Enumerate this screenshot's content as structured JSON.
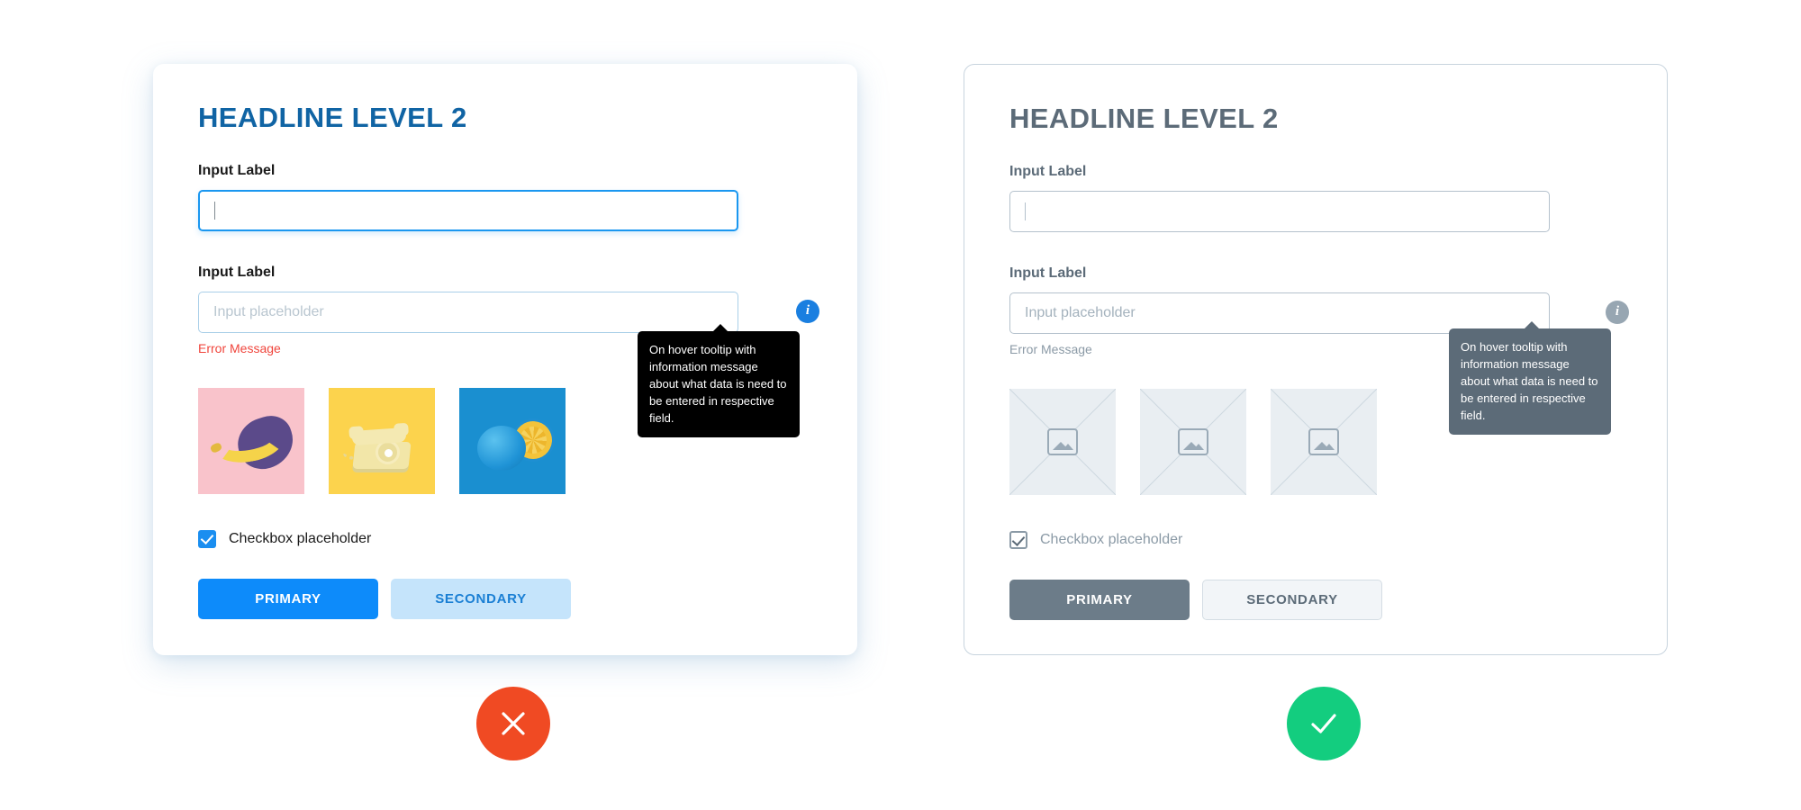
{
  "page": {
    "background_color": "#ffffff",
    "description": "Form design comparison: accessible colored variant vs low-contrast grayscale variant"
  },
  "cards": [
    {
      "id": "color-card",
      "variant": "color",
      "headline": "HEADLINE LEVEL 2",
      "headline_color": "#1064a4",
      "fields": [
        {
          "label": "Input Label",
          "state": "focused",
          "value": "",
          "placeholder": "",
          "border_color": "#1a97f0"
        },
        {
          "label": "Input Label",
          "state": "error",
          "value": "",
          "placeholder": "Input placeholder",
          "error": "Error Message",
          "error_color": "#f0453c",
          "info_icon": "info-icon",
          "info_icon_color": "#1a7fe0"
        }
      ],
      "tooltip": {
        "text": "On hover tooltip with information message about what data is need to be entered in respective field.",
        "background_color": "#000000",
        "text_color": "#ffffff"
      },
      "thumbnails": [
        {
          "name": "banana-photo",
          "alt": "Yellow banana on pink background",
          "background_color": "#f9c3cb"
        },
        {
          "name": "rotary-phone-photo",
          "alt": "Vintage rotary phone on yellow background",
          "background_color": "#fcd34d"
        },
        {
          "name": "blue-orange-photo",
          "alt": "Blue painted orange on blue background",
          "background_color": "#1a8fd0"
        }
      ],
      "checkbox": {
        "label": "Checkbox placeholder",
        "checked": true,
        "color": "#1a8ef0"
      },
      "buttons": {
        "primary": "PRIMARY",
        "primary_color": "#0d8bfa",
        "secondary": "SECONDARY",
        "secondary_color": "#c5e4fb"
      }
    },
    {
      "id": "gray-card",
      "variant": "grayscale",
      "headline": "HEADLINE LEVEL 2",
      "headline_color": "#5c6b78",
      "fields": [
        {
          "label": "Input Label",
          "state": "default",
          "value": "",
          "placeholder": "",
          "border_color": "#b4c1cc"
        },
        {
          "label": "Input Label",
          "state": "error",
          "value": "",
          "placeholder": "Input placeholder",
          "error": "Error Message",
          "error_color": "#8b9aa6",
          "info_icon": "info-icon",
          "info_icon_color": "#97a6b2"
        }
      ],
      "tooltip": {
        "text": "On hover tooltip with information message about what data is need to be entered in respective field.",
        "background_color": "#5c6b78",
        "text_color": "#ffffff"
      },
      "thumbnails": [
        {
          "name": "image-placeholder",
          "alt": "Image placeholder",
          "background_color": "#e9eef2"
        },
        {
          "name": "image-placeholder",
          "alt": "Image placeholder",
          "background_color": "#e9eef2"
        },
        {
          "name": "image-placeholder",
          "alt": "Image placeholder",
          "background_color": "#e9eef2"
        }
      ],
      "checkbox": {
        "label": "Checkbox placeholder",
        "checked": true,
        "color": "#8b9aa6"
      },
      "buttons": {
        "primary": "PRIMARY",
        "primary_color": "#6c7c89",
        "secondary": "SECONDARY",
        "secondary_color": "#f2f5f8"
      }
    }
  ],
  "verdicts": [
    {
      "name": "cross-icon",
      "meaning": "incorrect",
      "color": "#f04a23"
    },
    {
      "name": "check-icon",
      "meaning": "correct",
      "color": "#13cd7f"
    }
  ]
}
